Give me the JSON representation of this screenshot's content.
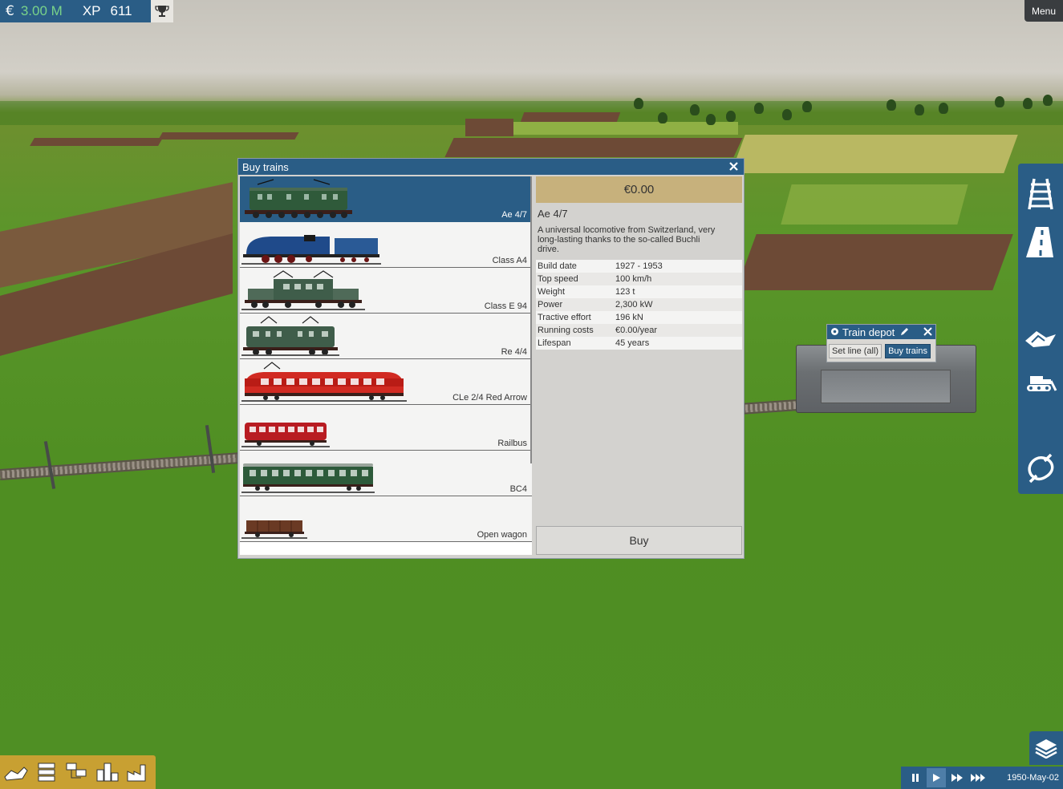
{
  "hud": {
    "currency_symbol": "€",
    "money": "3.00 M",
    "xp_label": "XP",
    "xp_value": "611",
    "trophy_icon": "trophy-icon"
  },
  "menu": {
    "label": "Menu"
  },
  "buy_trains": {
    "title": "Buy trains",
    "items": [
      {
        "name": "Ae 4/7",
        "selected": true
      },
      {
        "name": "Class A4",
        "selected": false
      },
      {
        "name": "Class E 94",
        "selected": false
      },
      {
        "name": "Re 4/4",
        "selected": false
      },
      {
        "name": "CLe 2/4 Red Arrow",
        "selected": false
      },
      {
        "name": "Railbus",
        "selected": false
      },
      {
        "name": "BC4",
        "selected": false
      },
      {
        "name": "Open wagon",
        "selected": false
      }
    ],
    "detail": {
      "price": "€0.00",
      "name": "Ae 4/7",
      "description": "A universal locomotive from Switzerland, very long-lasting thanks to the so-called Buchli drive.",
      "specs": [
        {
          "label": "Build date",
          "value": "1927 - 1953"
        },
        {
          "label": "Top speed",
          "value": "100 km/h"
        },
        {
          "label": "Weight",
          "value": "123 t"
        },
        {
          "label": "Power",
          "value": "2,300 kW"
        },
        {
          "label": "Tractive effort",
          "value": "196 kN"
        },
        {
          "label": "Running costs",
          "value": "€0.00/year"
        },
        {
          "label": "Lifespan",
          "value": "45 years"
        }
      ],
      "buy_label": "Buy"
    }
  },
  "train_depot": {
    "title": "Train depot",
    "set_line_label": "Set line (all)",
    "buy_trains_label": "Buy trains"
  },
  "time": {
    "date": "1950-May-02"
  },
  "colors": {
    "ui_blue": "#2a5d86",
    "money_green": "#79d389",
    "price_gold": "#c7b17c",
    "bottom_bar_gold": "#c8a032"
  }
}
